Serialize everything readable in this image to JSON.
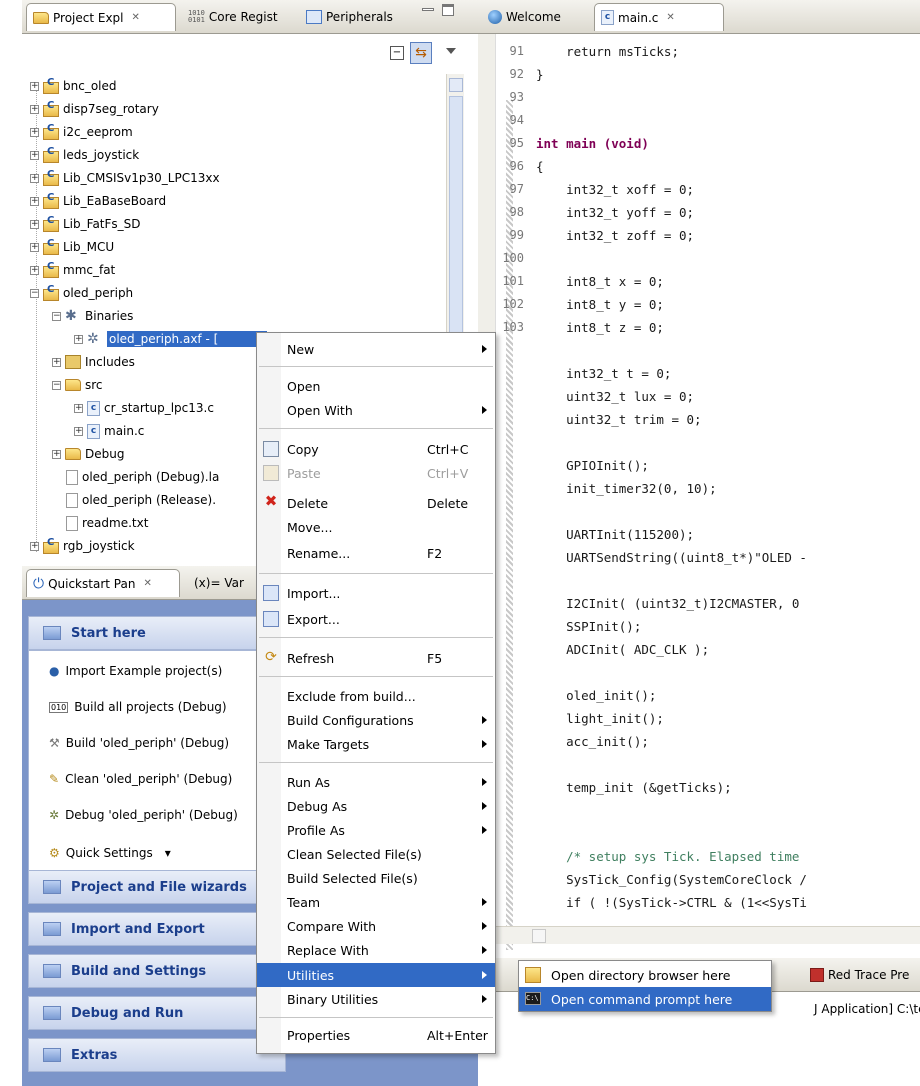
{
  "left_top_tabs": [
    {
      "label": "Project Expl",
      "glyph": "✕"
    },
    {
      "label": "Core Regist",
      "icon_text": "1010\n0101"
    },
    {
      "label": "Peripherals"
    }
  ],
  "tree": [
    {
      "label": "bnc_oled"
    },
    {
      "label": "disp7seg_rotary"
    },
    {
      "label": "i2c_eeprom"
    },
    {
      "label": "leds_joystick"
    },
    {
      "label": "Lib_CMSISv1p30_LPC13xx"
    },
    {
      "label": "Lib_EaBaseBoard"
    },
    {
      "label": "Lib_FatFs_SD"
    },
    {
      "label": "Lib_MCU"
    },
    {
      "label": "mmc_fat"
    },
    {
      "label": "oled_periph"
    },
    {
      "label": "Binaries"
    },
    {
      "label": "oled_periph.axf - ["
    },
    {
      "label": "Includes"
    },
    {
      "label": "src"
    },
    {
      "label": "cr_startup_lpc13.c"
    },
    {
      "label": "main.c"
    },
    {
      "label": "Debug"
    },
    {
      "label": "oled_periph (Debug).la"
    },
    {
      "label": "oled_periph (Release)."
    },
    {
      "label": "readme.txt"
    },
    {
      "label": "rgb_joystick"
    }
  ],
  "quickstart_tabs": [
    {
      "label": "Quickstart Pan",
      "glyph": "✕"
    },
    {
      "label": "(x)= Var"
    }
  ],
  "quickstart": {
    "start_here": "Start here",
    "items": [
      "Import Example project(s)",
      "Build all projects (Debug)",
      "Build 'oled_periph' (Debug)",
      "Clean 'oled_periph' (Debug)",
      "Debug 'oled_periph' (Debug)"
    ],
    "quick_settings": "Quick Settings",
    "sections": [
      "Project and File wizards",
      "Import and Export",
      "Build and Settings",
      "Debug and Run",
      "Extras"
    ]
  },
  "editor_tabs": [
    {
      "label": "Welcome"
    },
    {
      "label": "main.c",
      "glyph": "✕"
    }
  ],
  "code": [
    {
      "n": "91",
      "t": "    return msTicks;"
    },
    {
      "n": "92",
      "t": "}"
    },
    {
      "n": "93",
      "t": ""
    },
    {
      "n": "94",
      "t": ""
    },
    {
      "n": "95",
      "t": "int main (void)"
    },
    {
      "n": "96",
      "t": "{"
    },
    {
      "n": "97",
      "t": "    int32_t xoff = 0;"
    },
    {
      "n": "98",
      "t": "    int32_t yoff = 0;"
    },
    {
      "n": "99",
      "t": "    int32_t zoff = 0;"
    },
    {
      "n": "100",
      "t": ""
    },
    {
      "n": "101",
      "t": "    int8_t x = 0;"
    },
    {
      "n": "102",
      "t": "    int8_t y = 0;"
    },
    {
      "n": "103",
      "t": "    int8_t z = 0;"
    },
    {
      "n": "",
      "t": ""
    },
    {
      "n": "",
      "t": "    int32_t t = 0;"
    },
    {
      "n": "",
      "t": "    uint32_t lux = 0;"
    },
    {
      "n": "",
      "t": "    uint32_t trim = 0;"
    },
    {
      "n": "",
      "t": ""
    },
    {
      "n": "",
      "t": "    GPIOInit();"
    },
    {
      "n": "",
      "t": "    init_timer32(0, 10);"
    },
    {
      "n": "",
      "t": ""
    },
    {
      "n": "",
      "t": "    UARTInit(115200);"
    },
    {
      "n": "",
      "t": "    UARTSendString((uint8_t*)\"OLED -"
    },
    {
      "n": "",
      "t": ""
    },
    {
      "n": "",
      "t": "    I2CInit( (uint32_t)I2CMASTER, 0"
    },
    {
      "n": "",
      "t": "    SSPInit();"
    },
    {
      "n": "",
      "t": "    ADCInit( ADC_CLK );"
    },
    {
      "n": "",
      "t": ""
    },
    {
      "n": "",
      "t": "    oled_init();"
    },
    {
      "n": "",
      "t": "    light_init();"
    },
    {
      "n": "",
      "t": "    acc_init();"
    },
    {
      "n": "",
      "t": ""
    },
    {
      "n": "",
      "t": "    temp_init (&getTicks);"
    },
    {
      "n": "",
      "t": ""
    },
    {
      "n": "",
      "t": ""
    },
    {
      "n": "",
      "t": "    /* setup sys Tick. Elapsed time"
    },
    {
      "n": "",
      "t": "    SysTick_Config(SystemCoreClock /"
    },
    {
      "n": "",
      "t": "    if ( !(SysTick->CTRL & (1<<SysTi"
    }
  ],
  "bottom_panel": {
    "tab_label": "Red Trace Pre",
    "console_line": "J Application] C:\\ter"
  },
  "context_menu": [
    {
      "label": "New",
      "submenu": true
    },
    {
      "sep": true
    },
    {
      "label": "Open"
    },
    {
      "label": "Open With",
      "submenu": true
    },
    {
      "sep": true
    },
    {
      "label": "Copy",
      "accel": "Ctrl+C",
      "icon": "copy-icon"
    },
    {
      "label": "Paste",
      "accel": "Ctrl+V",
      "icon": "paste-icon",
      "disabled": true
    },
    {
      "label": "Delete",
      "accel": "Delete",
      "icon": "delete-icon"
    },
    {
      "label": "Move..."
    },
    {
      "label": "Rename...",
      "accel": "F2"
    },
    {
      "sep": true
    },
    {
      "label": "Import...",
      "icon": "import-icon"
    },
    {
      "label": "Export...",
      "icon": "export-icon"
    },
    {
      "sep": true
    },
    {
      "label": "Refresh",
      "accel": "F5",
      "icon": "refresh-icon"
    },
    {
      "sep": true
    },
    {
      "label": "Exclude from build..."
    },
    {
      "label": "Build Configurations",
      "submenu": true
    },
    {
      "label": "Make Targets",
      "submenu": true
    },
    {
      "sep": true
    },
    {
      "label": "Run As",
      "submenu": true
    },
    {
      "label": "Debug As",
      "submenu": true
    },
    {
      "label": "Profile As",
      "submenu": true
    },
    {
      "label": "Clean Selected File(s)"
    },
    {
      "label": "Build Selected File(s)"
    },
    {
      "label": "Team",
      "submenu": true
    },
    {
      "label": "Compare With",
      "submenu": true
    },
    {
      "label": "Replace With",
      "submenu": true
    },
    {
      "label": "Utilities",
      "submenu": true,
      "selected": true
    },
    {
      "label": "Binary Utilities",
      "submenu": true
    },
    {
      "sep": true
    },
    {
      "label": "Properties",
      "accel": "Alt+Enter"
    }
  ],
  "submenu": [
    {
      "label": "Open directory browser here",
      "icon": "folder-open-icon"
    },
    {
      "label": "Open command prompt here",
      "icon": "command-prompt-icon",
      "selected": true
    }
  ],
  "colors": {
    "selection": "#316ac5",
    "keyword": "#7f0055",
    "string": "#2a00ff",
    "comment": "#3f7f5f"
  }
}
